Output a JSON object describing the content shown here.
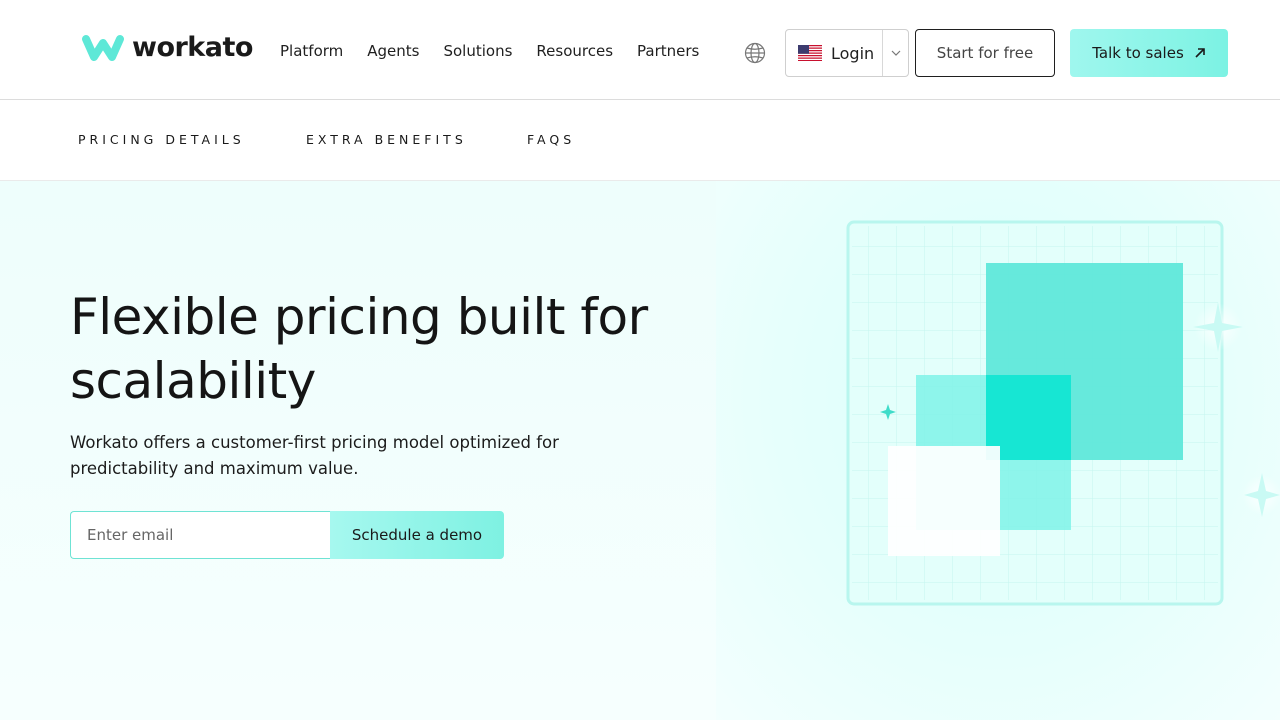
{
  "brand": {
    "name": "workato",
    "accent": "#5ee8d7"
  },
  "nav": {
    "items": [
      {
        "label": "Platform"
      },
      {
        "label": "Agents"
      },
      {
        "label": "Solutions"
      },
      {
        "label": "Resources"
      },
      {
        "label": "Partners"
      }
    ],
    "language_icon": "globe-icon",
    "login": {
      "label": "Login",
      "flag": "us-flag-icon",
      "dropdown_icon": "chevron-down-icon"
    },
    "start_label": "Start for free",
    "sales_label": "Talk to sales",
    "sales_icon": "arrow-up-right-icon"
  },
  "subnav": {
    "items": [
      {
        "label": "PRICING DETAILS"
      },
      {
        "label": "EXTRA BENEFITS"
      },
      {
        "label": "FAQS"
      }
    ]
  },
  "hero": {
    "headline": "Flexible pricing built for scalability",
    "subtext": "Workato offers a customer-first pricing model optimized for predictability and maximum value.",
    "email_placeholder": "Enter email",
    "email_value": "",
    "cta_label": "Schedule a demo"
  }
}
